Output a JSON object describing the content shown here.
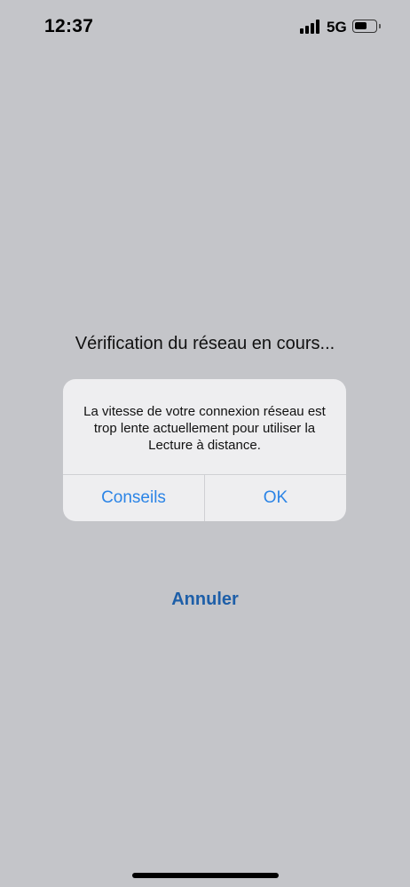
{
  "status_bar": {
    "time": "12:37",
    "network": "5G",
    "signal_icon": "cellular-signal-icon",
    "battery_icon": "battery-icon",
    "battery_level": 0.6
  },
  "main": {
    "checking_text": "Vérification du réseau en cours..."
  },
  "alert": {
    "message": "La vitesse de votre connexion réseau est trop lente actuellement pour utiliser la Lecture à distance.",
    "left_button": "Conseils",
    "right_button": "OK",
    "button_color": "#2b84e6"
  },
  "cancel": {
    "label": "Annuler",
    "color": "#1e5fa8"
  },
  "colors": {
    "background": "#c4c5c9",
    "alert_background": "#eeeef0"
  }
}
